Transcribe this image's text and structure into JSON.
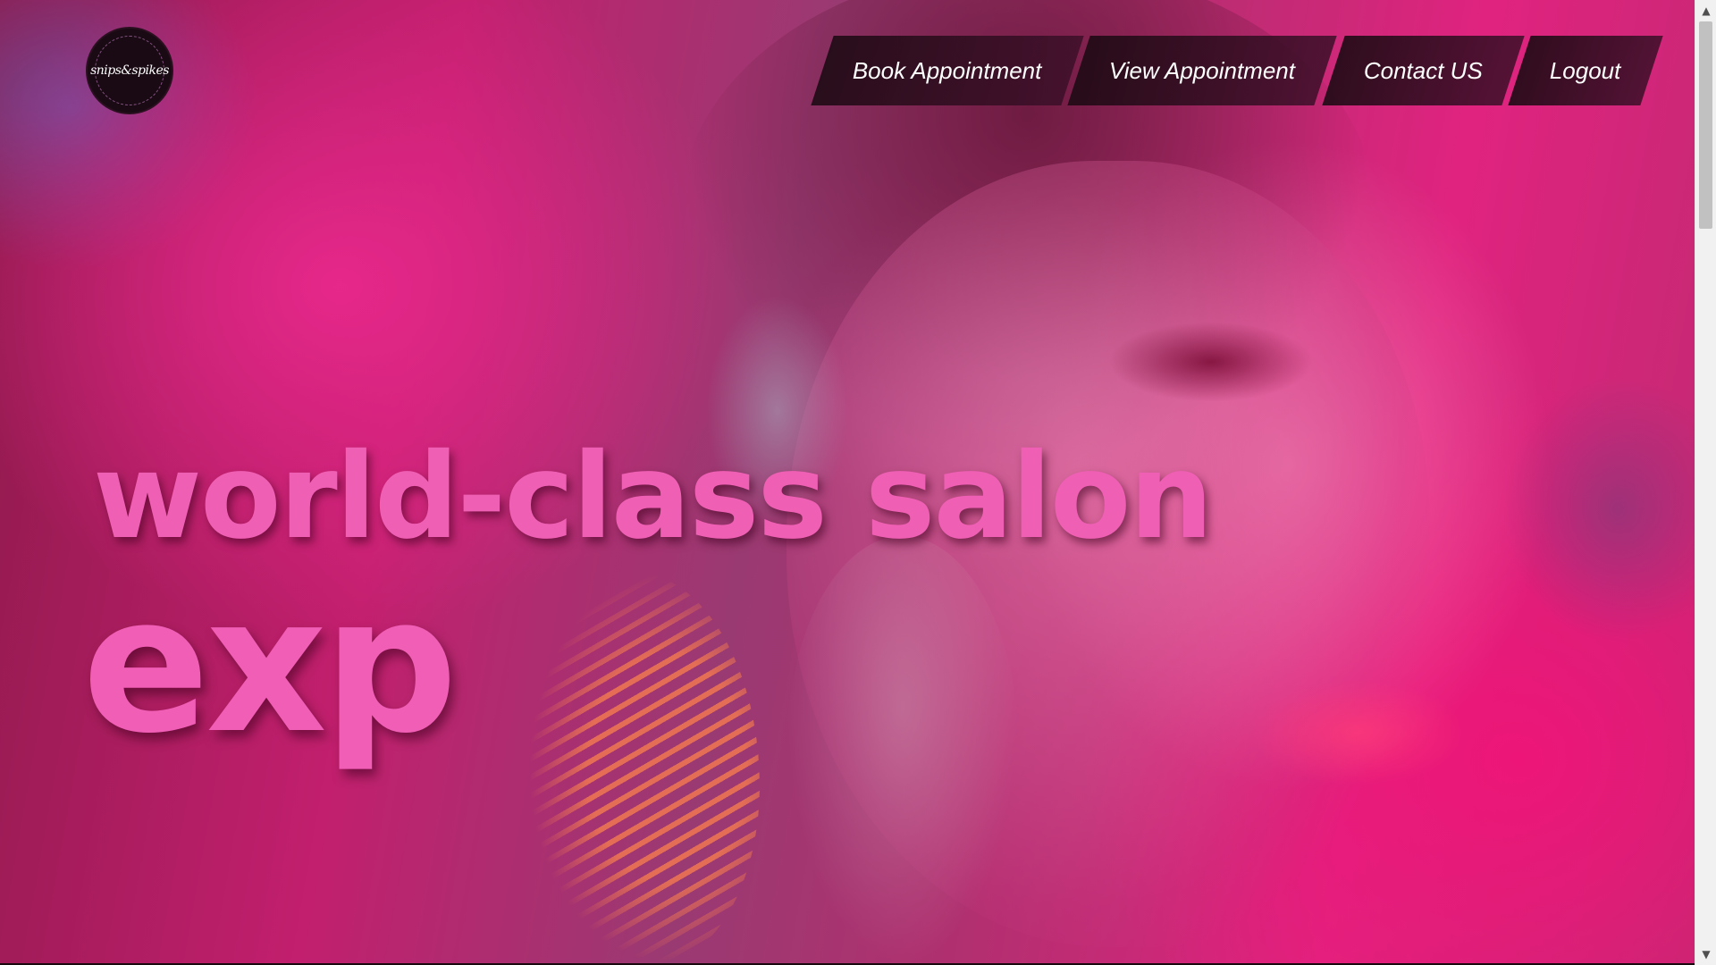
{
  "logo": {
    "text": "snips&spikes",
    "icon": "salon-logo-icon"
  },
  "nav": {
    "items": [
      {
        "label": "Book Appointment"
      },
      {
        "label": "View Appointment"
      },
      {
        "label": "Contact US"
      },
      {
        "label": "Logout"
      }
    ]
  },
  "hero": {
    "headline": "world-class salon",
    "typed_text": "exp"
  },
  "scrollbar": {
    "up_icon": "chevron-up-icon",
    "down_icon": "chevron-down-icon"
  },
  "colors": {
    "accent": "#ef5fb4",
    "nav_bg": "#2a0c1c",
    "hero_magenta": "#e0237f"
  }
}
